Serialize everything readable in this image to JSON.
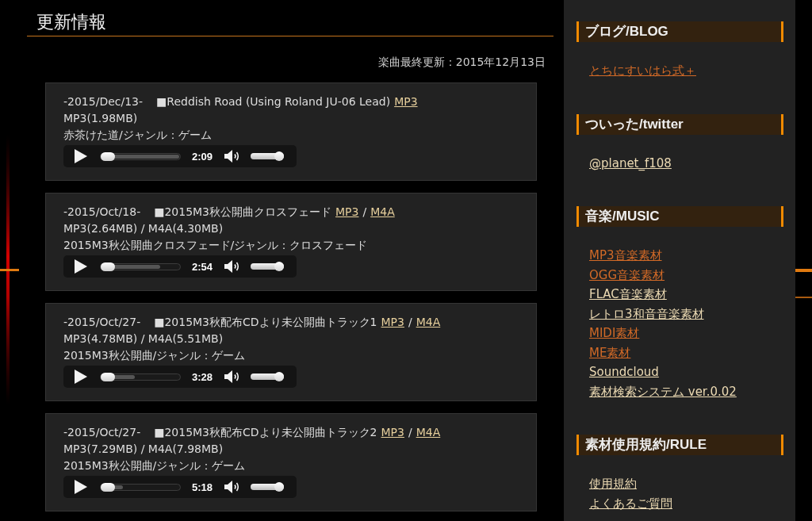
{
  "main": {
    "heading": "更新情報",
    "last_updated": "楽曲最終更新：2015年12月13日"
  },
  "tracks": [
    {
      "date": "-2015/Dec/13-",
      "title": "■Reddish Road (Using Roland JU-06 Lead)",
      "links": [
        {
          "kind": "link",
          "text": "MP3"
        }
      ],
      "sizes": "MP3(1.98MB)",
      "genre": "赤茶けた道/ジャンル：ゲーム",
      "player": {
        "progress": {
          "level": 0,
          "buffered": {
            "level": 1
          }
        },
        "duration": "2:09",
        "volume": {
          "level": 1
        }
      }
    },
    {
      "date": "-2015/Oct/18-",
      "title": "■2015M3秋公開曲クロスフェード",
      "links": [
        {
          "kind": "link",
          "text": "MP3"
        },
        {
          "kind": "separator",
          "text": "/"
        },
        {
          "kind": "link",
          "text": "M4A"
        }
      ],
      "sizes": "MP3(2.64MB) / M4A(4.30MB)",
      "genre": "2015M3秋公開曲クロスフェード/ジャンル：クロスフェード",
      "player": {
        "progress": {
          "level": 0,
          "buffered": {
            "level": 0.75
          }
        },
        "duration": "2:54",
        "volume": {
          "level": 1
        }
      }
    },
    {
      "date": "-2015/Oct/27-",
      "title": "■2015M3秋配布CDより未公開曲トラック1",
      "links": [
        {
          "kind": "link",
          "text": "MP3"
        },
        {
          "kind": "separator",
          "text": "/"
        },
        {
          "kind": "link",
          "text": "M4A"
        }
      ],
      "sizes": "MP3(4.78MB) / M4A(5.51MB)",
      "genre": "2015M3秋公開曲/ジャンル：ゲーム",
      "player": {
        "progress": {
          "level": 0,
          "buffered": {
            "level": 0.43
          }
        },
        "duration": "3:28",
        "volume": {
          "level": 1
        }
      }
    },
    {
      "date": "-2015/Oct/27-",
      "title": "■2015M3秋配布CDより未公開曲トラック2",
      "links": [
        {
          "kind": "link",
          "text": "MP3"
        },
        {
          "kind": "separator",
          "text": "/"
        },
        {
          "kind": "link",
          "text": "M4A"
        }
      ],
      "sizes": "MP3(7.29MB) / M4A(7.98MB)",
      "genre": "2015M3秋公開曲/ジャンル：ゲーム",
      "player": {
        "progress": {
          "level": 0,
          "buffered": {
            "level": 0.28
          }
        },
        "duration": "5:18",
        "volume": {
          "level": 1
        }
      }
    }
  ],
  "sidebar": {
    "sections": [
      {
        "title": "ブログ/BLOG",
        "links": [
          {
            "text": "とちにすいはら式＋",
            "visited": true
          }
        ]
      },
      {
        "title": "ついった/twitter",
        "links": [
          {
            "text": "@planet_f108",
            "visited": false
          }
        ]
      },
      {
        "title": "音楽/MUSIC",
        "links": [
          {
            "text": "MP3音楽素材",
            "visited": true
          },
          {
            "text": "OGG音楽素材",
            "visited": true
          },
          {
            "text": "FLAC音楽素材",
            "visited": false
          },
          {
            "text": "レトロ3和音音楽素材",
            "visited": false
          },
          {
            "text": "MIDI素材",
            "visited": true
          },
          {
            "text": "ME素材",
            "visited": true
          },
          {
            "text": "Soundcloud",
            "visited": false
          },
          {
            "text": "素材検索システム ver.0.02",
            "visited": false
          }
        ]
      },
      {
        "title": "素材使用規約/RULE",
        "links": [
          {
            "text": "使用規約",
            "visited": false
          },
          {
            "text": "よくあるご質問",
            "visited": false
          }
        ]
      }
    ]
  }
}
